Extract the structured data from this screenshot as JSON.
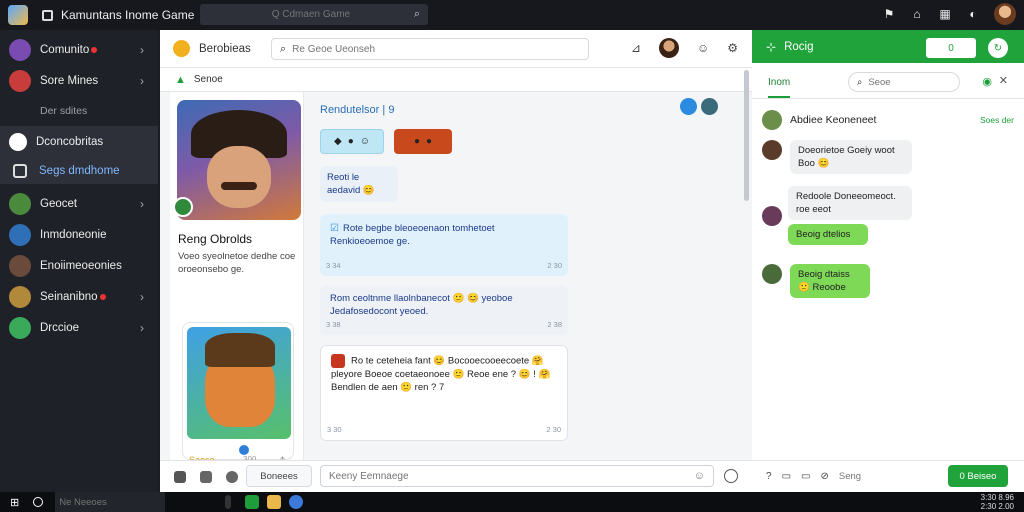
{
  "topbar": {
    "title": "Kamuntans Inome Game",
    "search_placeholder": "Q Cdmaen Game",
    "search_icon": "search-icon",
    "icons": [
      "rocket-icon",
      "home-icon",
      "grid-icon",
      "moon-icon"
    ]
  },
  "sidebar": {
    "items": [
      {
        "label": "Comunito",
        "icon_color": "#7a4bb0",
        "badge": true,
        "chevron": true
      },
      {
        "label": "Sore Mines",
        "icon_color": "#c83c3c",
        "badge": false,
        "chevron": true
      }
    ],
    "section_label": "Der sdites",
    "active_item": "Dconcobritas",
    "sub_item": "Segs dmdhome",
    "items2": [
      {
        "label": "Geocet",
        "icon_color": "#4a8a3c",
        "badge": false,
        "chevron": true
      },
      {
        "label": "Inmdoneonie",
        "icon_color": "#2f6fb5",
        "badge": false,
        "chevron": false
      },
      {
        "label": "Enoiimeoeonies",
        "icon_color": "#6a4a3a",
        "badge": false,
        "chevron": false
      },
      {
        "label": "Seinanibno",
        "icon_color": "#b08a3a",
        "badge": true,
        "chevron": true
      },
      {
        "label": "Drccioe",
        "icon_color": "#3aaa5a",
        "badge": false,
        "chevron": true
      }
    ]
  },
  "chat": {
    "channel_name": "Berobieas",
    "search_placeholder": "Re Geoe Ueonseh",
    "subheader": "Senoe",
    "profile": {
      "name": "Reng Obrolds",
      "bio": "Voeo syeolnetoe dedhe coe oroeonsebo ge.",
      "card_label": "Saose",
      "card_count": "300"
    },
    "room_title": "Rendutelsor",
    "room_count": "9",
    "messages": [
      {
        "text": "Reoti le aedavid 😊",
        "time": "",
        "time2": ""
      },
      {
        "text": "Rote begbe bleoeoenaon tomhetoet Renkioeoemoe ge.",
        "time": "3 34",
        "time2": "2 30"
      },
      {
        "text": "Rom ceoltnme llaolnbanecot 🙂 😊 yeoboe Jedafosedocont yeoed.",
        "time": "3 38",
        "time2": "2 38"
      },
      {
        "text": "Ro te ceteheia fant 😊 Bocooecooeecoete 🤗 pleyore Boeoe coetaeonoee 🙂 Reoe ene ? 😊 ! 🤗 Bendlen de aen 🙂 ren ? 7",
        "time": "3 30",
        "time2": "2 30"
      }
    ]
  },
  "composer": {
    "tab_label": "Boneees",
    "placeholder": "Keeny Eemnaege"
  },
  "right_panel": {
    "title": "Rocig",
    "pill_label": "0",
    "tab_label": "Inom",
    "search_placeholder": "Seoe",
    "thread_name": "Abdiee Keoneneet",
    "thread_link": "Soes der",
    "messages": [
      {
        "text": "Doeorietoe Goeiy woot Boo 😊",
        "color": "grey"
      },
      {
        "text": "Redoole Doneeomeoct. roe eeot",
        "color": "grey"
      },
      {
        "text": "Beoig dtelios",
        "color": "green"
      },
      {
        "text": "Beoig dtaiss 🙂 Reoobe",
        "color": "green"
      }
    ],
    "footer_label": "Seng",
    "send_label": "0 Beiseo"
  },
  "taskbar": {
    "search_placeholder": "Ne Neeoes",
    "clock_time": "3:30 8.96",
    "clock_date": "2:30 2.00"
  },
  "colors": {
    "accent_green": "#20a33a",
    "sidebar_bg": "#1f2128",
    "bubble_blue": "#e1f1fb"
  }
}
